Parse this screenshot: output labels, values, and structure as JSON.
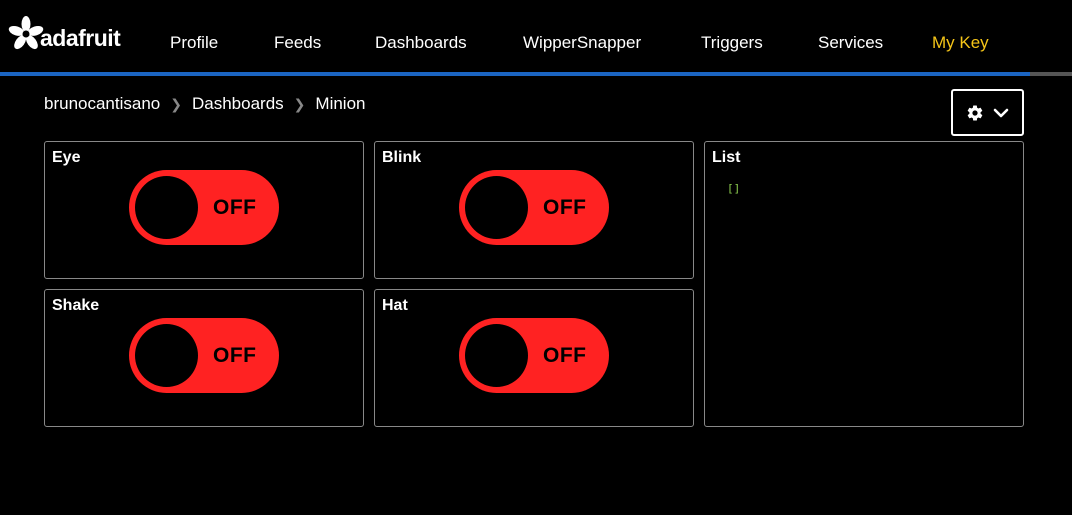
{
  "brand": {
    "name": "adafruit"
  },
  "nav": {
    "items": [
      {
        "label": "Profile"
      },
      {
        "label": "Feeds"
      },
      {
        "label": "Dashboards"
      },
      {
        "label": "WipperSnapper"
      },
      {
        "label": "Triggers"
      },
      {
        "label": "Services"
      },
      {
        "label": "My Key"
      }
    ]
  },
  "colors": {
    "accent": "#1b65c2",
    "key_highlight": "#f5c518",
    "toggle_off": "#ff2222"
  },
  "breadcrumb": {
    "items": [
      {
        "label": "brunocantisano"
      },
      {
        "label": "Dashboards"
      },
      {
        "label": "Minion"
      }
    ]
  },
  "settings": {
    "icon": "gear-icon",
    "dropdown_icon": "chevron-down-icon"
  },
  "blocks": [
    {
      "title": "Eye",
      "state": "OFF"
    },
    {
      "title": "Blink",
      "state": "OFF"
    },
    {
      "title": "Shake",
      "state": "OFF"
    },
    {
      "title": "Hat",
      "state": "OFF"
    }
  ],
  "list_block": {
    "title": "List",
    "content": "[]"
  }
}
